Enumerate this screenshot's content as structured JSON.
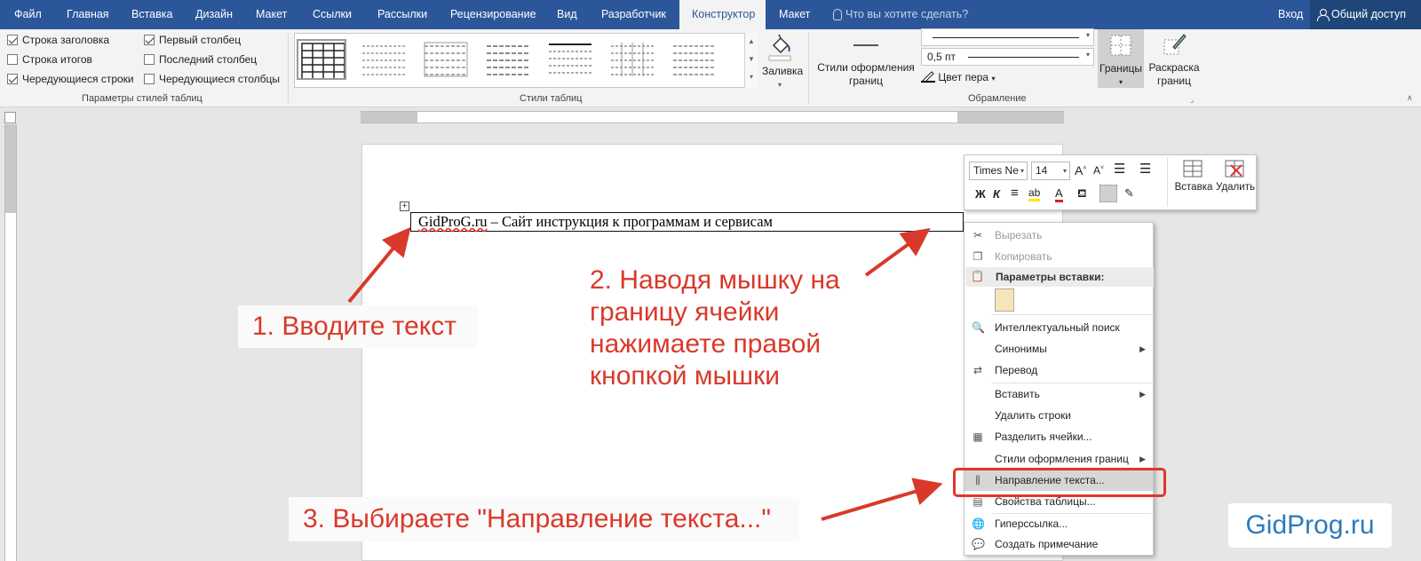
{
  "tabs": [
    {
      "label": "Файл",
      "active": false
    },
    {
      "label": "Главная",
      "active": false
    },
    {
      "label": "Вставка",
      "active": false
    },
    {
      "label": "Дизайн",
      "active": false
    },
    {
      "label": "Макет",
      "active": false
    },
    {
      "label": "Ссылки",
      "active": false
    },
    {
      "label": "Рассылки",
      "active": false
    },
    {
      "label": "Рецензирование",
      "active": false
    },
    {
      "label": "Вид",
      "active": false
    },
    {
      "label": "Разработчик",
      "active": false
    },
    {
      "label": "Конструктор",
      "active": true
    },
    {
      "label": "Макет",
      "active": false
    }
  ],
  "tell_me": "Что вы хотите сделать?",
  "login": "Вход",
  "share": "Общий доступ",
  "style_options": {
    "group_label": "Параметры стилей таблиц",
    "items": [
      {
        "label": "Строка заголовка",
        "checked": true
      },
      {
        "label": "Строка итогов",
        "checked": false
      },
      {
        "label": "Чередующиеся строки",
        "checked": true
      },
      {
        "label": "Первый столбец",
        "checked": true
      },
      {
        "label": "Последний столбец",
        "checked": false
      },
      {
        "label": "Чередующиеся столбцы",
        "checked": false
      }
    ]
  },
  "table_styles": {
    "group_label": "Стили таблиц",
    "shading_label": "Заливка"
  },
  "borders": {
    "group_label": "Обрамление",
    "border_styles_label": "Стили оформления границ",
    "pen_weight": "0,5 пт",
    "pen_color_label": "Цвет пера",
    "borders_label": "Границы",
    "painter_label": "Раскраска границ"
  },
  "document": {
    "cell_text_spell": "GidProG.ru",
    "cell_text_rest": " – Сайт инструкция к программам и сервисам"
  },
  "mini_toolbar": {
    "font": "Times Ne",
    "size": "14",
    "insert_label": "Вставка",
    "delete_label": "Удалить"
  },
  "context_menu": {
    "cut": "Вырезать",
    "copy": "Копировать",
    "paste_header": "Параметры вставки:",
    "smart_lookup": "Интеллектуальный поиск",
    "synonyms": "Синонимы",
    "translate": "Перевод",
    "insert": "Вставить",
    "delete_rows": "Удалить строки",
    "split_cells": "Разделить ячейки...",
    "border_styles": "Стили оформления границ",
    "text_direction": "Направление текста...",
    "table_props": "Свойства таблицы...",
    "hyperlink": "Гиперссылка...",
    "add_comment": "Создать примечание"
  },
  "annotations": {
    "step1": "1. Вводите текст",
    "step2_lines": [
      "2. Наводя мышку на",
      "границу ячейки",
      "нажимаете правой",
      "кнопкой мышки"
    ],
    "step3": "3. Выбираете \"Направление текста...\"",
    "brand": "GidProg.ru"
  },
  "colors": {
    "accent": "#2b579a",
    "annotation_red": "#d9392a",
    "brand_blue": "#2b7bbd"
  }
}
